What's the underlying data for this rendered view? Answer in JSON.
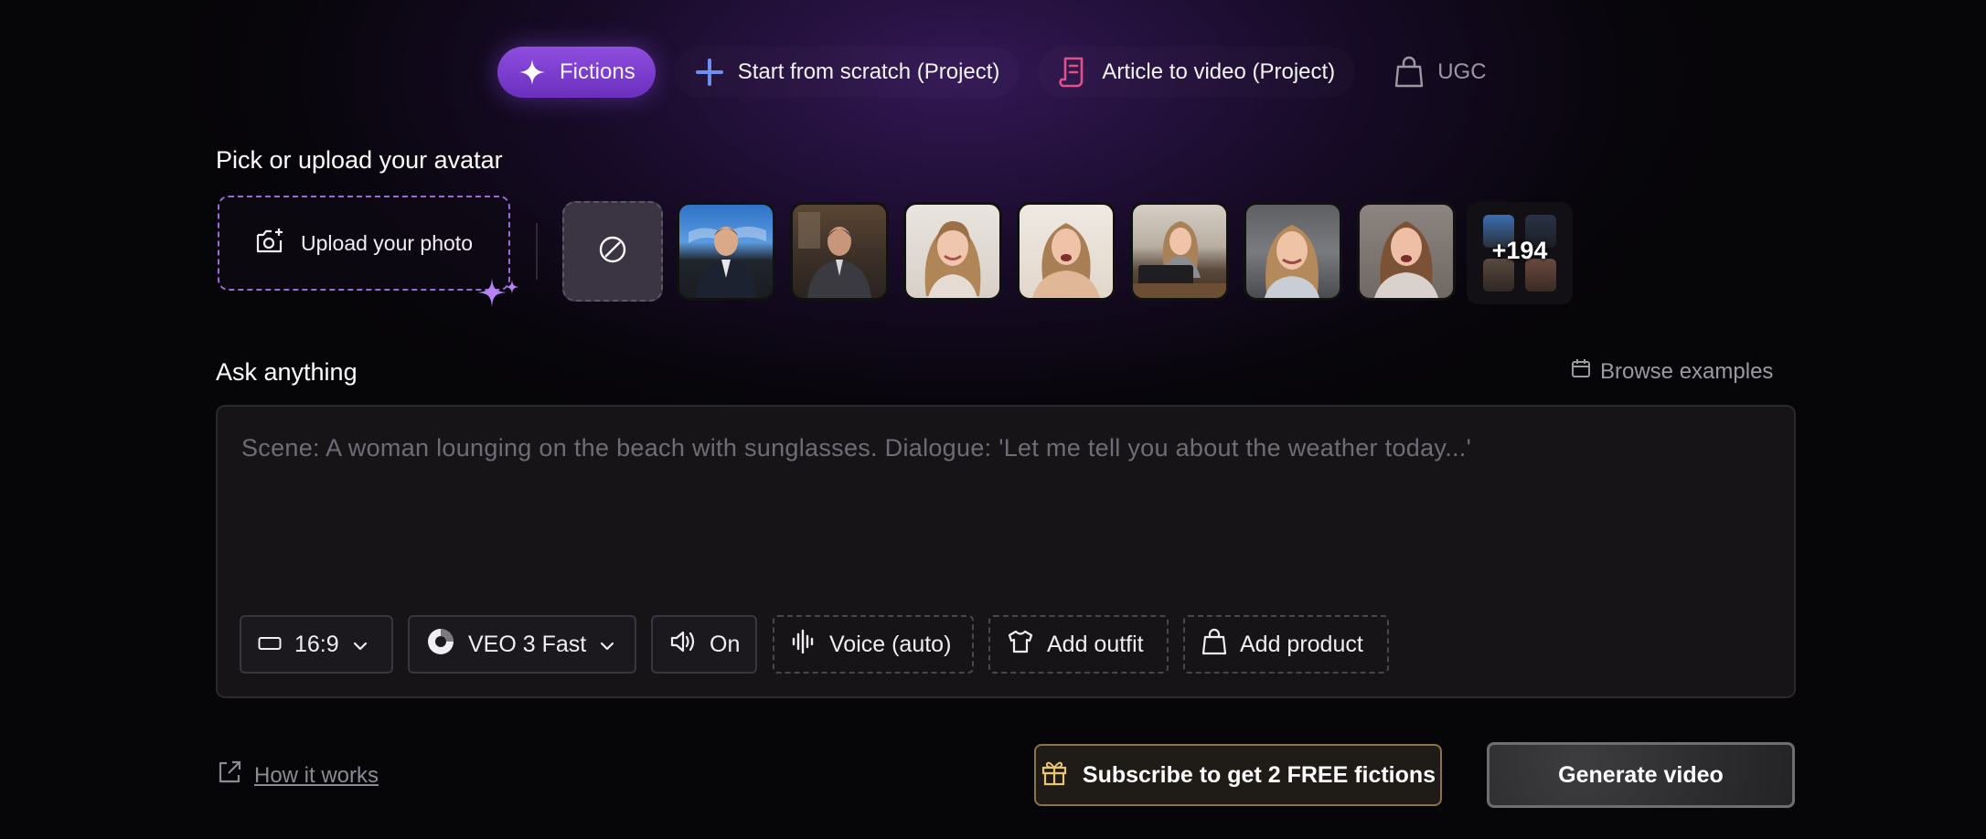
{
  "tabs": [
    {
      "label": "Fictions",
      "icon": "sparkle-icon",
      "active": true
    },
    {
      "label": "Start from scratch (Project)",
      "icon": "plus-icon"
    },
    {
      "label": "Article to video (Project)",
      "icon": "document-icon"
    },
    {
      "label": "UGC",
      "icon": "shopping-bag-icon"
    }
  ],
  "avatar_section": {
    "title": "Pick or upload your avatar",
    "upload_label": "Upload your photo",
    "more_count": "+194"
  },
  "prompt_section": {
    "title": "Ask anything",
    "browse_label": "Browse examples",
    "placeholder": "Scene: A woman lounging on the beach with sunglasses. Dialogue: 'Let me tell you about the weather today...'"
  },
  "controls": {
    "aspect_ratio": "16:9",
    "model": "VEO 3 Fast",
    "audio": "On",
    "voice": "Voice (auto)",
    "outfit": "Add outfit",
    "product": "Add product"
  },
  "footer": {
    "how_it_works": "How it works",
    "subscribe": "Subscribe to get 2 FREE fictions",
    "generate": "Generate video"
  },
  "colors": {
    "accent_purple": "#7b3fd0",
    "plus_blue": "#6f8ff0",
    "doc_pink": "#e0508a",
    "upload_border": "#9a6bd6"
  }
}
